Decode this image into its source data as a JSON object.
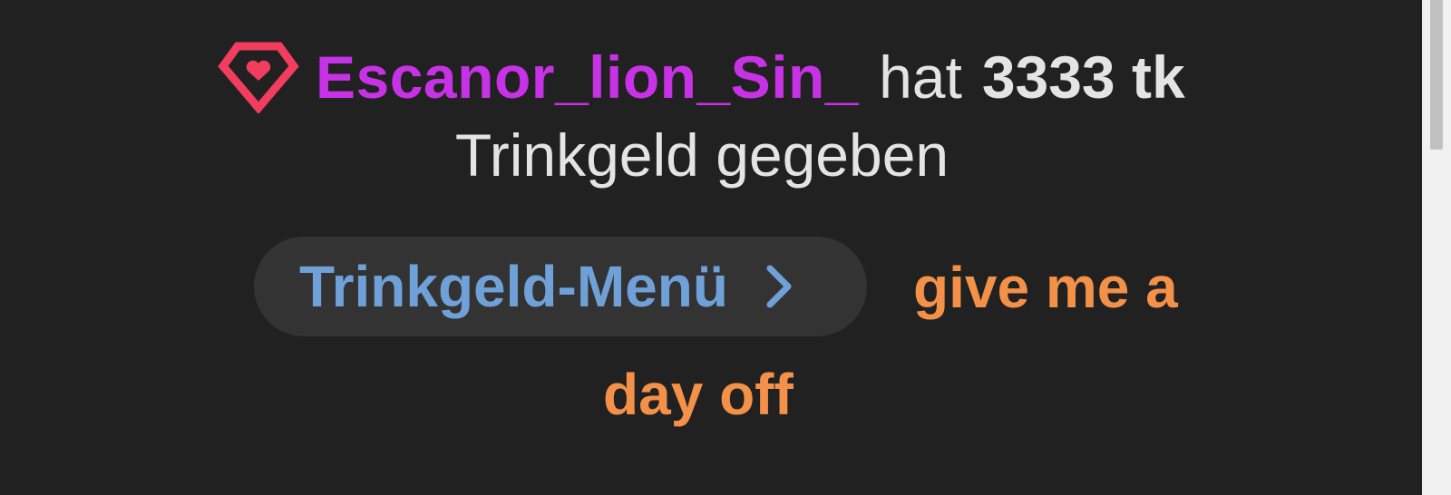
{
  "tip_event": {
    "icon": "tip-heart-icon",
    "username": "Escanor_lion_Sin_",
    "username_color": "#c832e6",
    "text_before_amount": "hat",
    "amount": "3333 tk",
    "text_after_amount": "Trinkgeld gegeben"
  },
  "tip_menu": {
    "label": "Trinkgeld-Menü",
    "icon": "chevron-right-icon",
    "label_color": "#6fa1d8"
  },
  "tip_note": {
    "line1": "give me a",
    "line2": "day off",
    "color": "#f39148"
  },
  "colors": {
    "background": "#212121",
    "icon": "#f23d5e"
  }
}
